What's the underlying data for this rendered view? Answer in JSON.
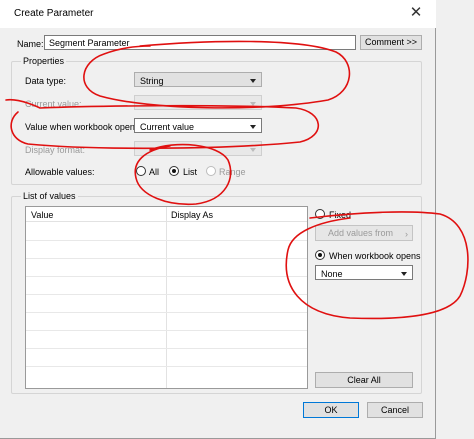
{
  "window": {
    "title": "Create Parameter"
  },
  "name_row": {
    "label": "Name:",
    "value": "Segment Parameter",
    "comment_button": "Comment >>"
  },
  "properties": {
    "group_title": "Properties",
    "data_type": {
      "label": "Data type:",
      "value": "String"
    },
    "current_value": {
      "label": "Current value:",
      "value": ""
    },
    "value_when_opens": {
      "label": "Value when workbook opens:",
      "value": "Current value"
    },
    "display_format": {
      "label": "Display format:",
      "value": ""
    },
    "allowable_values": {
      "label": "Allowable values:",
      "options": [
        {
          "label": "All",
          "checked": false,
          "enabled": true
        },
        {
          "label": "List",
          "checked": true,
          "enabled": true
        },
        {
          "label": "Range",
          "checked": false,
          "enabled": false
        }
      ]
    }
  },
  "list_of_values": {
    "group_title": "List of values",
    "columns": [
      "Value",
      "Display As"
    ],
    "rows": [],
    "fixed_label": "Fixed",
    "add_values_from_label": "Add values from",
    "when_workbook_opens_label": "When workbook opens",
    "workbook_open_source": "None",
    "clear_all_label": "Clear All"
  },
  "footer": {
    "ok_label": "OK",
    "cancel_label": "Cancel"
  },
  "colors": {
    "annotation": "#e01010",
    "accent": "#0078d7"
  },
  "icons": {
    "close": "close-icon",
    "dropdown": "chevron-down-icon",
    "submenu": "chevron-right-icon"
  }
}
